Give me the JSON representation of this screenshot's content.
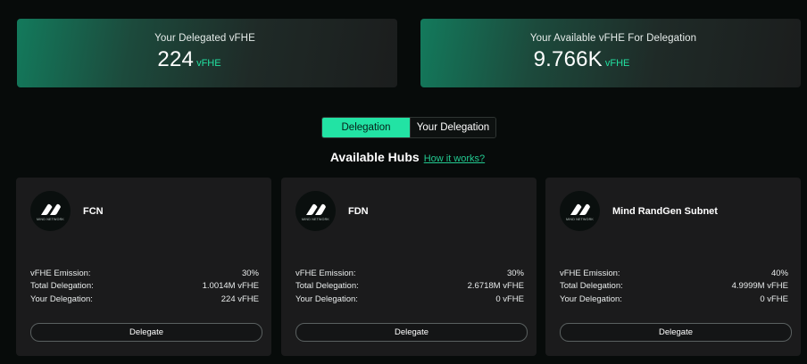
{
  "stats": {
    "delegated": {
      "label": "Your Delegated vFHE",
      "value": "224",
      "unit": "vFHE"
    },
    "available": {
      "label": "Your Available vFHE For Delegation",
      "value": "9.766K",
      "unit": "vFHE"
    }
  },
  "tabs": [
    {
      "label": "Delegation",
      "active": true
    },
    {
      "label": "Your Delegation",
      "active": false
    }
  ],
  "hubs_section": {
    "title": "Available Hubs",
    "link": "How it works?"
  },
  "hubs": [
    {
      "name": "FCN",
      "logo_text": "MIND NETWORK",
      "emission_label": "vFHE Emission:",
      "emission": "30%",
      "total_label": "Total Delegation:",
      "total": "1.0014M vFHE",
      "yours_label": "Your Delegation:",
      "yours": "224 vFHE",
      "button": "Delegate"
    },
    {
      "name": "FDN",
      "logo_text": "MIND NETWORK",
      "emission_label": "vFHE Emission:",
      "emission": "30%",
      "total_label": "Total Delegation:",
      "total": "2.6718M vFHE",
      "yours_label": "Your Delegation:",
      "yours": "0 vFHE",
      "button": "Delegate"
    },
    {
      "name": "Mind RandGen Subnet",
      "logo_text": "MIND NETWORK",
      "emission_label": "vFHE Emission:",
      "emission": "40%",
      "total_label": "Total Delegation:",
      "total": "4.9999M vFHE",
      "yours_label": "Your Delegation:",
      "yours": "0 vFHE",
      "button": "Delegate"
    }
  ],
  "colors": {
    "accent": "#22e3a4",
    "background": "#070b0a",
    "card": "#1b1b1c"
  },
  "icons": {
    "hub_logo": "mind-network-logo-icon"
  }
}
